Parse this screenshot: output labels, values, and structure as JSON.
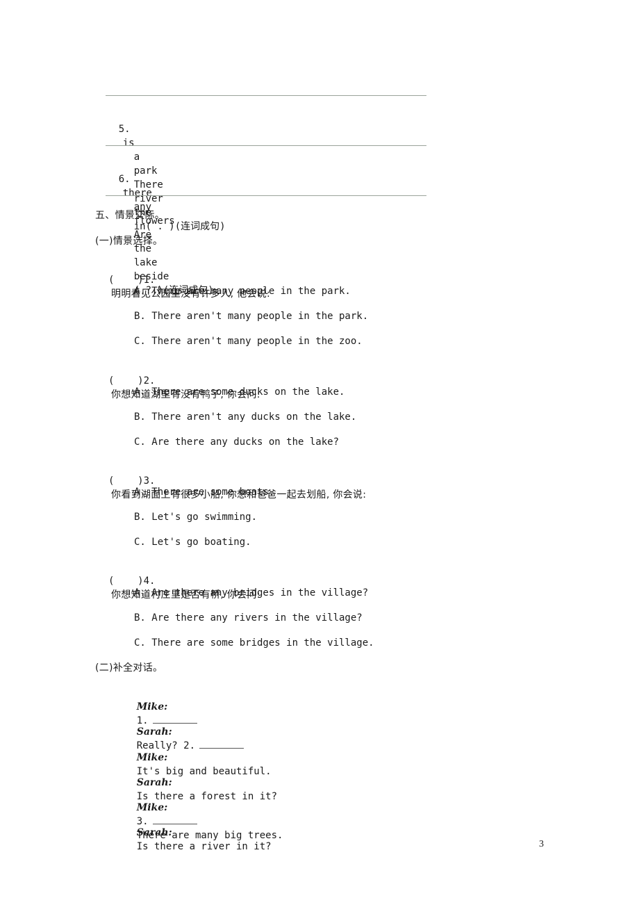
{
  "reorder": [
    {
      "number": "5.",
      "words": [
        "is",
        "a",
        "park",
        "There",
        "river",
        "the"
      ],
      "tail": "in( . )(连词成句)"
    },
    {
      "number": "6.",
      "words": [
        "there",
        "any",
        "flowers",
        "Are",
        "the",
        "lake",
        "beside"
      ],
      "tail": "( ? )(连词成句)"
    }
  ],
  "section5": {
    "title": "五、情景交际。",
    "part1_title": "(一)情景选择。",
    "questions": [
      {
        "bracket": "(    )",
        "number": "1.",
        "prompt": "明明看见公园里没有许多人, 他会说:",
        "options": [
          "A. There are many people in the park.",
          "B. There aren't many people in the park.",
          "C. There aren't many people in the zoo."
        ]
      },
      {
        "bracket": "(    )",
        "number": "2.",
        "prompt": "你想知道湖里有没有鸭子, 你会问:",
        "options": [
          "A. There are some ducks on the lake.",
          "B. There aren't any ducks on the lake.",
          "C. Are there any ducks on the lake?"
        ]
      },
      {
        "bracket": "(    )",
        "number": "3.",
        "prompt": "你看到湖面上有很多小船, 你想和爸爸一起去划船, 你会说:",
        "options": [
          "A. There are some boats.",
          "B. Let's go swimming.",
          "C. Let's go boating."
        ]
      },
      {
        "bracket": "(    )",
        "number": "4.",
        "prompt": "你想知道村庄里是否有桥, 你会问:",
        "options": [
          "A. Are there any bridges in the village?",
          "B. Are there any rivers in the village?",
          "C. There are some bridges in the village."
        ]
      }
    ],
    "part2_title": "(二)补全对话。",
    "dialogue": [
      {
        "speaker": "Mike:",
        "before": "1.",
        "blank": true,
        "after": ""
      },
      {
        "speaker": "Sarah:",
        "before": "Really? 2.",
        "blank": true,
        "after": ""
      },
      {
        "speaker": "Mike:",
        "before": "It's big and beautiful.",
        "blank": false,
        "after": ""
      },
      {
        "speaker": "Sarah:",
        "before": "Is there a forest in it?",
        "blank": false,
        "after": ""
      },
      {
        "speaker": "Mike:",
        "before": "3.",
        "blank": true,
        "after": "There are many big trees."
      },
      {
        "speaker": "Sarah:",
        "before": "Is there a river in it?",
        "blank": false,
        "after": ""
      }
    ]
  },
  "page_number": "3"
}
